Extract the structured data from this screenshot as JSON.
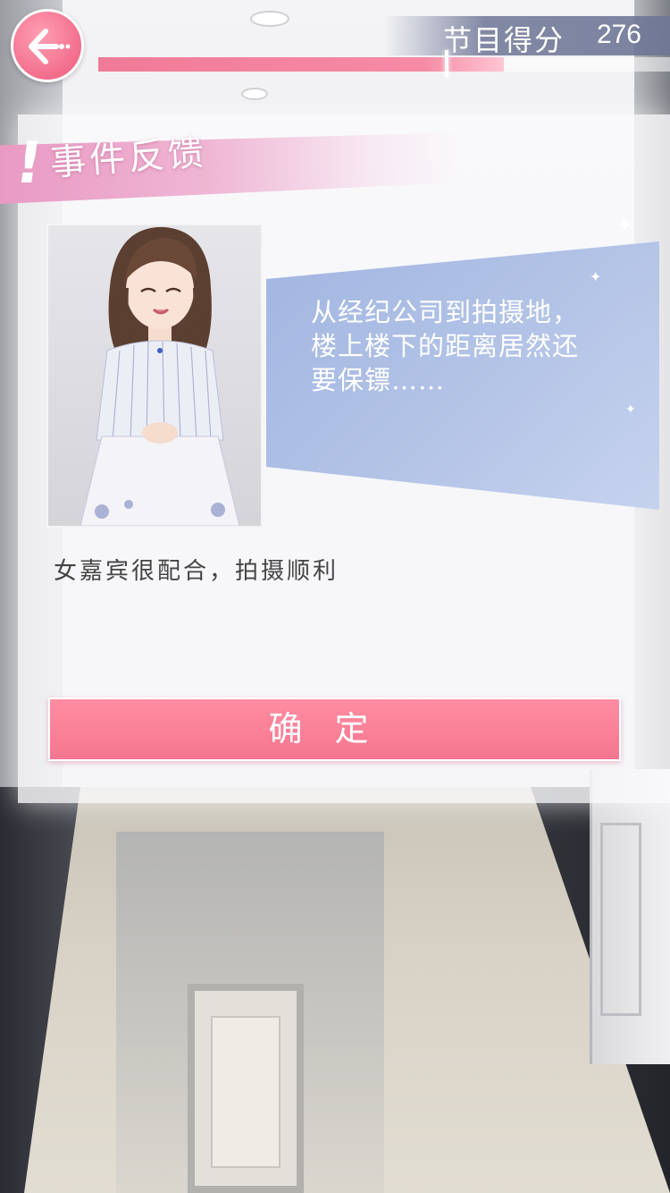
{
  "hud": {
    "back_icon": "arrow-left-icon",
    "score_label": "节目得分",
    "score_value": "276",
    "score_progress": 0.71,
    "accent_color": "#f57690"
  },
  "panel": {
    "header_mark": "!",
    "title": "事件反馈",
    "character_icon": "character-portrait",
    "speech_lines": [
      "从经纪公司到拍摄地，",
      "楼上楼下的距离居然还",
      "要保镖……"
    ],
    "result": "女嘉宾很配合，拍摄顺利",
    "confirm_label": "确定",
    "bubble_color": "#9db2df",
    "header_color": "#e99ac3"
  }
}
